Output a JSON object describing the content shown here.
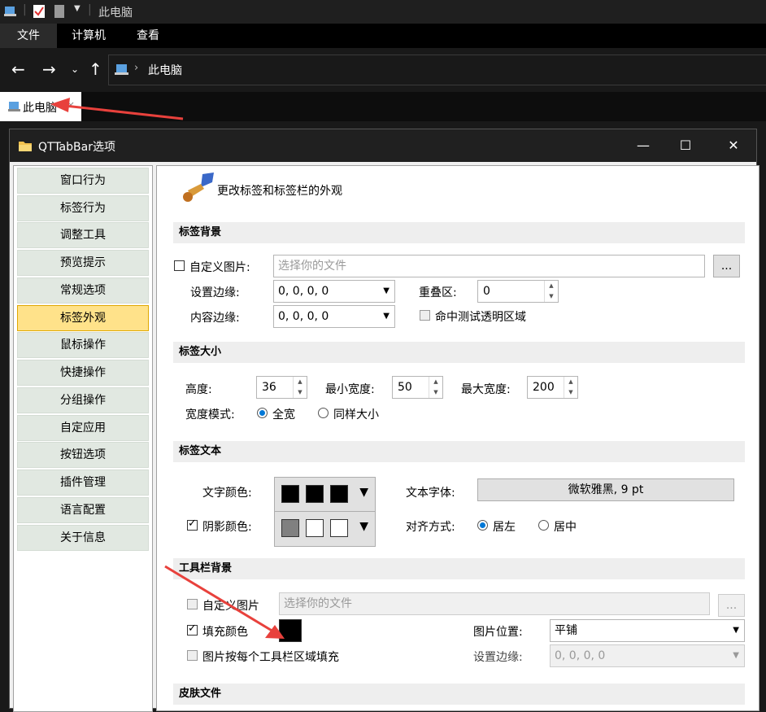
{
  "explorer": {
    "title": "此电脑",
    "ribbon_tabs": [
      "文件",
      "计算机",
      "查看"
    ],
    "address": "此电脑",
    "tab_label": "此电脑"
  },
  "dialog": {
    "title": "QTTabBar选项",
    "sidebar": [
      "窗口行为",
      "标签行为",
      "调整工具",
      "预览提示",
      "常规选项",
      "标签外观",
      "鼠标操作",
      "快捷操作",
      "分组操作",
      "自定应用",
      "按钮选项",
      "插件管理",
      "语言配置",
      "关于信息"
    ],
    "selected_index": 5,
    "header": "更改标签和标签栏的外观",
    "tab_background": {
      "section": "标签背景",
      "custom_image_label": "自定义图片:",
      "file_placeholder": "选择你的文件",
      "browse": "...",
      "margin_label": "设置边缘:",
      "margin_value": "0, 0, 0, 0",
      "overlap_label": "重叠区:",
      "overlap_value": "0",
      "content_margin_label": "内容边缘:",
      "content_margin_value": "0, 0, 0, 0",
      "hit_test_label": "命中测试透明区域"
    },
    "tab_size": {
      "section": "标签大小",
      "height_label": "高度:",
      "height_value": "36",
      "min_width_label": "最小宽度:",
      "min_width_value": "50",
      "max_width_label": "最大宽度:",
      "max_width_value": "200",
      "width_mode_label": "宽度模式:",
      "opt_full": "全宽",
      "opt_same": "同样大小"
    },
    "tab_text": {
      "section": "标签文本",
      "text_color_label": "文字颜色:",
      "font_label": "文本字体:",
      "font_value": "微软雅黑, 9 pt",
      "shadow_label": "阴影颜色:",
      "align_label": "对齐方式:",
      "opt_left": "居左",
      "opt_center": "居中",
      "text_colors": [
        "#000000",
        "#000000",
        "#000000"
      ],
      "shadow_colors": [
        "#808080",
        "#ffffff",
        "#ffffff"
      ]
    },
    "toolbar_bg": {
      "section": "工具栏背景",
      "custom_image_label": "自定义图片",
      "file_placeholder": "选择你的文件",
      "browse": "...",
      "fill_color_label": "填充颜色",
      "fill_color": "#000000",
      "image_pos_label": "图片位置:",
      "image_pos_value": "平铺",
      "per_area_label": "图片按每个工具栏区域填充",
      "margin_label": "设置边缘:",
      "margin_value": "0, 0, 0, 0"
    },
    "skin_section": "皮肤文件",
    "window_buttons": [
      "—",
      "☐",
      "✕"
    ]
  },
  "colors": {
    "accent": "#0078d7",
    "selected_sidebar": "#ffe28a",
    "arrow": "#e8413c"
  }
}
